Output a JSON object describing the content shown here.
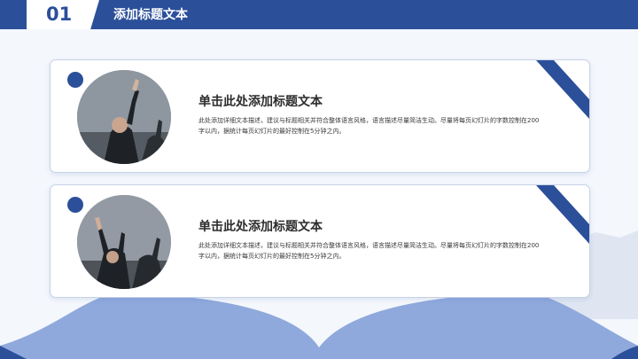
{
  "header": {
    "number": "01",
    "title": "添加标题文本"
  },
  "cards": [
    {
      "title": "单击此处添加标题文本",
      "description": "此处添加详细文本描述，建议与标题相关并符合整体语言风格，语言描述尽量简洁生动。尽量将每页幻灯片的字数控制在200字以内，据统计每页幻灯片的最好控制在5分钟之内。"
    },
    {
      "title": "单击此处添加标题文本",
      "description": "此处添加详细文本描述，建议与标题相关并符合整体语言风格，语言描述尽量简洁生动。尽量将每页幻灯片的字数控制在200字以内，据统计每页幻灯片的最好控制在5分钟之内。"
    }
  ],
  "colors": {
    "accent": "#2c4f9a",
    "wave_light": "#8fa9dc",
    "background": "#f4f7fc"
  }
}
